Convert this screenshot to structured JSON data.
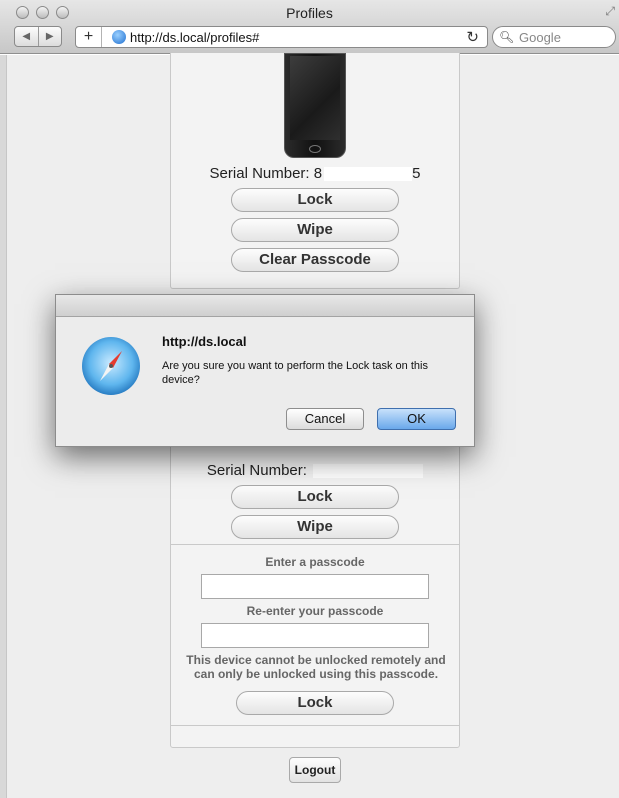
{
  "window": {
    "title": "Profiles"
  },
  "toolbar": {
    "url": "http://ds.local/profiles#",
    "search_placeholder": "Google"
  },
  "device_top": {
    "serial_label": "Serial Number:",
    "serial_prefix": "8",
    "serial_suffix": "5",
    "buttons": [
      "Lock",
      "Wipe",
      "Clear Passcode"
    ]
  },
  "device_bottom": {
    "serial_label": "Serial Number:",
    "buttons": [
      "Lock",
      "Wipe"
    ],
    "passcode_label": "Enter a passcode",
    "reenter_label": "Re-enter your passcode",
    "note": "This device cannot be unlocked remotely and can only be unlocked using this passcode.",
    "lock_button": "Lock"
  },
  "logout": "Logout",
  "dialog": {
    "title": "http://ds.local",
    "message": "Are you sure you want to perform the Lock task on this device?",
    "cancel": "Cancel",
    "ok": "OK"
  }
}
